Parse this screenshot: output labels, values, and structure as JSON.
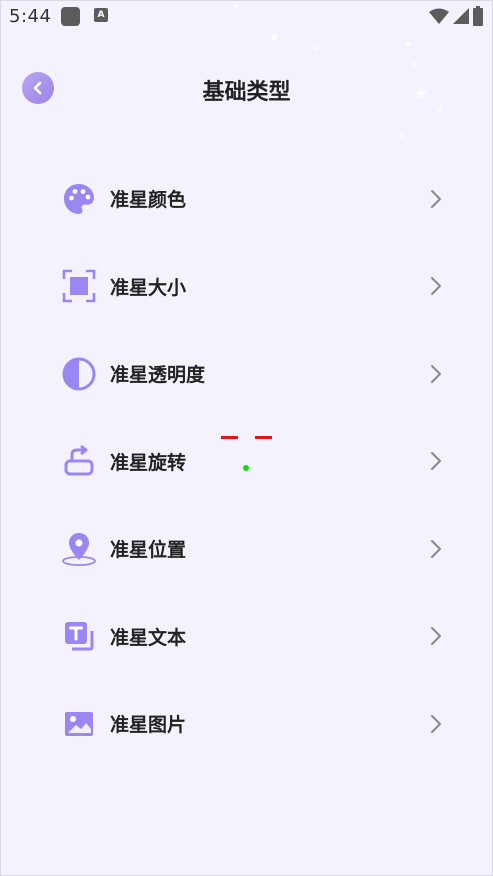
{
  "status_bar": {
    "time": "5:44",
    "app_icon_letter": "A",
    "icons": [
      "wifi-icon",
      "signal-icon",
      "battery-icon"
    ]
  },
  "header": {
    "title": "基础类型",
    "back_icon": "chevron-left-icon"
  },
  "menu": {
    "items": [
      {
        "label": "准星颜色",
        "icon": "palette-icon"
      },
      {
        "label": "准星大小",
        "icon": "resize-icon"
      },
      {
        "label": "准星透明度",
        "icon": "contrast-icon"
      },
      {
        "label": "准星旋转",
        "icon": "rotate-icon"
      },
      {
        "label": "准星位置",
        "icon": "location-pin-icon"
      },
      {
        "label": "准星文本",
        "icon": "text-box-icon"
      },
      {
        "label": "准星图片",
        "icon": "image-icon"
      }
    ]
  },
  "colors": {
    "background": "#f4f3fd",
    "accent": "#9b87f2",
    "text": "#222222",
    "crosshair_red": "#ee1111",
    "crosshair_green": "#11dd11"
  }
}
